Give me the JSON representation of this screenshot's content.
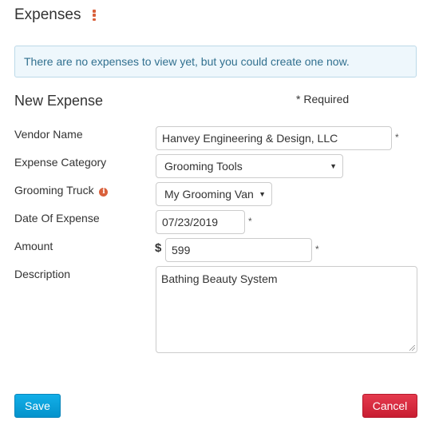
{
  "header": {
    "title": "Expenses",
    "menu_icon": "kebab-menu-icon"
  },
  "alert": {
    "message": "There are no expenses to view yet, but you could create one now."
  },
  "form": {
    "title": "New Expense",
    "required_note": "* Required",
    "required_marker": "*",
    "fields": {
      "vendor_name": {
        "label": "Vendor Name",
        "value": "Hanvey Engineering & Design, LLC",
        "required": true
      },
      "expense_category": {
        "label": "Expense Category",
        "value": "Grooming Tools"
      },
      "grooming_truck": {
        "label": "Grooming Truck",
        "value": "My Grooming Van",
        "info_icon": "info-icon",
        "info_glyph": "i"
      },
      "date_of_expense": {
        "label": "Date Of Expense",
        "value": "07/23/2019",
        "required": true
      },
      "amount": {
        "label": "Amount",
        "currency_symbol": "$",
        "value": "599",
        "required": true
      },
      "description": {
        "label": "Description",
        "value": "Bathing Beauty System"
      }
    },
    "caret_glyph": "▼",
    "buttons": {
      "save": "Save",
      "cancel": "Cancel"
    }
  },
  "colors": {
    "accent_orange": "#d9603b",
    "alert_bg": "#eef7fc",
    "alert_text": "#31708f",
    "save_blue": "#0ba2dc",
    "cancel_red": "#d62b40"
  }
}
